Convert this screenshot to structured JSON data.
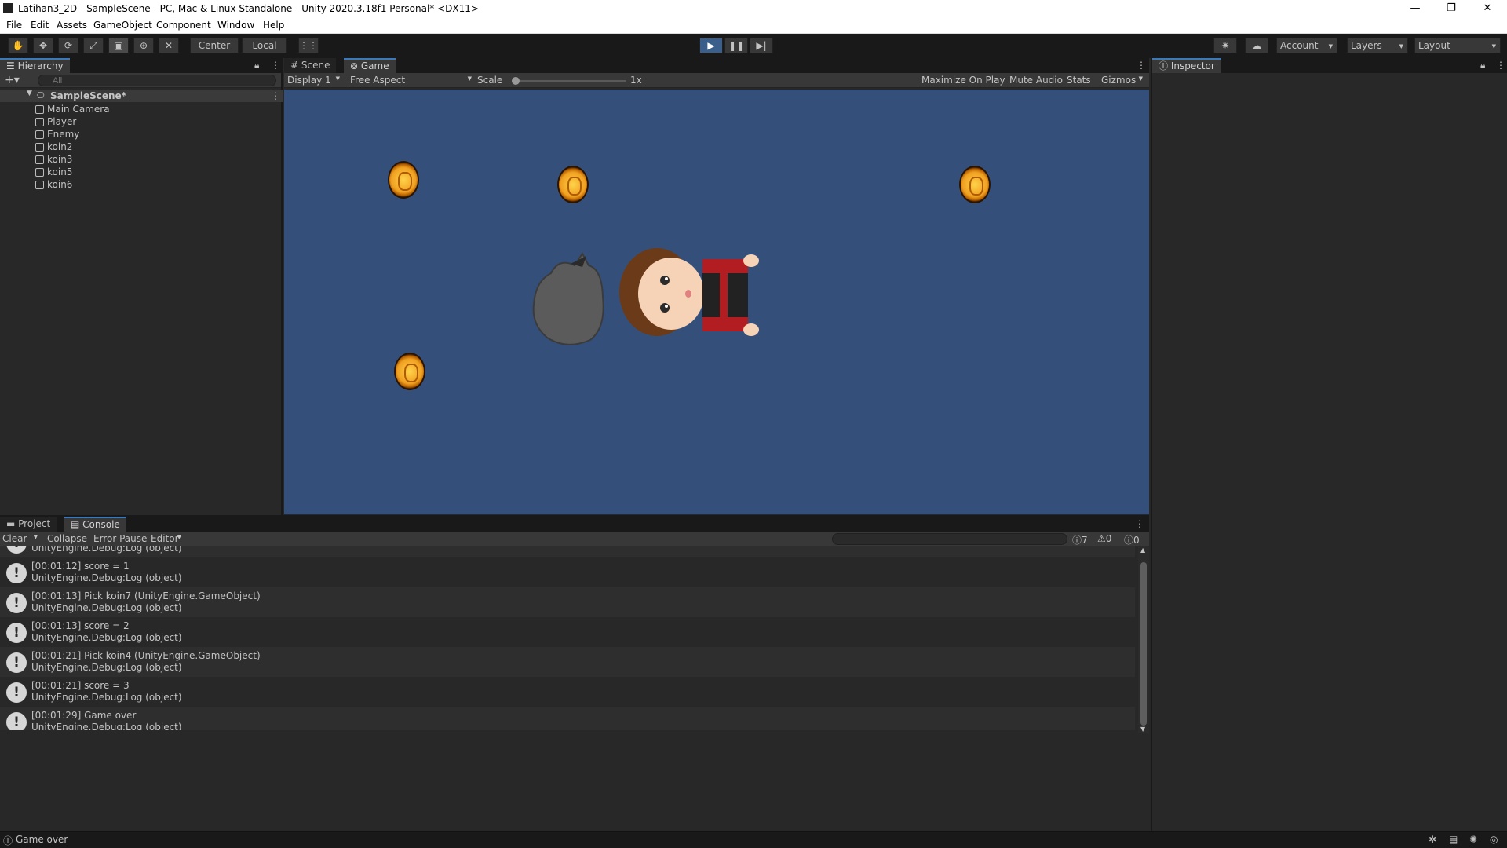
{
  "window": {
    "title": "Latihan3_2D - SampleScene - PC, Mac & Linux Standalone - Unity 2020.3.18f1 Personal* <DX11>",
    "minimize": "—",
    "maximize": "❐",
    "close": "✕"
  },
  "menu": [
    "File",
    "Edit",
    "Assets",
    "GameObject",
    "Component",
    "Window",
    "Help"
  ],
  "toolbar": {
    "pivot": "Center",
    "space": "Local",
    "account": "Account",
    "layers": "Layers",
    "layout": "Layout"
  },
  "hierarchy": {
    "tab": "Hierarchy",
    "search_placeholder": "All",
    "scene": "SampleScene*",
    "items": [
      "Main Camera",
      "Player",
      "Enemy",
      "koin2",
      "koin3",
      "koin5",
      "koin6"
    ]
  },
  "view": {
    "tabs": [
      "Scene",
      "Game"
    ],
    "display": "Display 1",
    "aspect": "Free Aspect",
    "scale_label": "Scale",
    "scale_value": "1x",
    "maximize": "Maximize On Play",
    "mute": "Mute Audio",
    "stats": "Stats",
    "gizmos": "Gizmos"
  },
  "inspector": {
    "tab": "Inspector"
  },
  "bottom": {
    "tabs": [
      "Project",
      "Console"
    ],
    "clear": "Clear",
    "collapse": "Collapse",
    "error_pause": "Error Pause",
    "editor": "Editor",
    "count_log": "7",
    "count_warn": "0",
    "count_err": "0",
    "partial_row": "UnityEngine.Debug:Log (object)",
    "logs": [
      {
        "l1": "[00:01:12] score = 1",
        "l2": "UnityEngine.Debug:Log (object)"
      },
      {
        "l1": "[00:01:13] Pick koin7 (UnityEngine.GameObject)",
        "l2": "UnityEngine.Debug:Log (object)"
      },
      {
        "l1": "[00:01:13] score = 2",
        "l2": "UnityEngine.Debug:Log (object)"
      },
      {
        "l1": "[00:01:21] Pick koin4 (UnityEngine.GameObject)",
        "l2": "UnityEngine.Debug:Log (object)"
      },
      {
        "l1": "[00:01:21] score = 3",
        "l2": "UnityEngine.Debug:Log (object)"
      },
      {
        "l1": "[00:01:29] Game  over",
        "l2": "UnityEngine.Debug:Log (object)"
      }
    ]
  },
  "status": {
    "message": "Game  over"
  }
}
